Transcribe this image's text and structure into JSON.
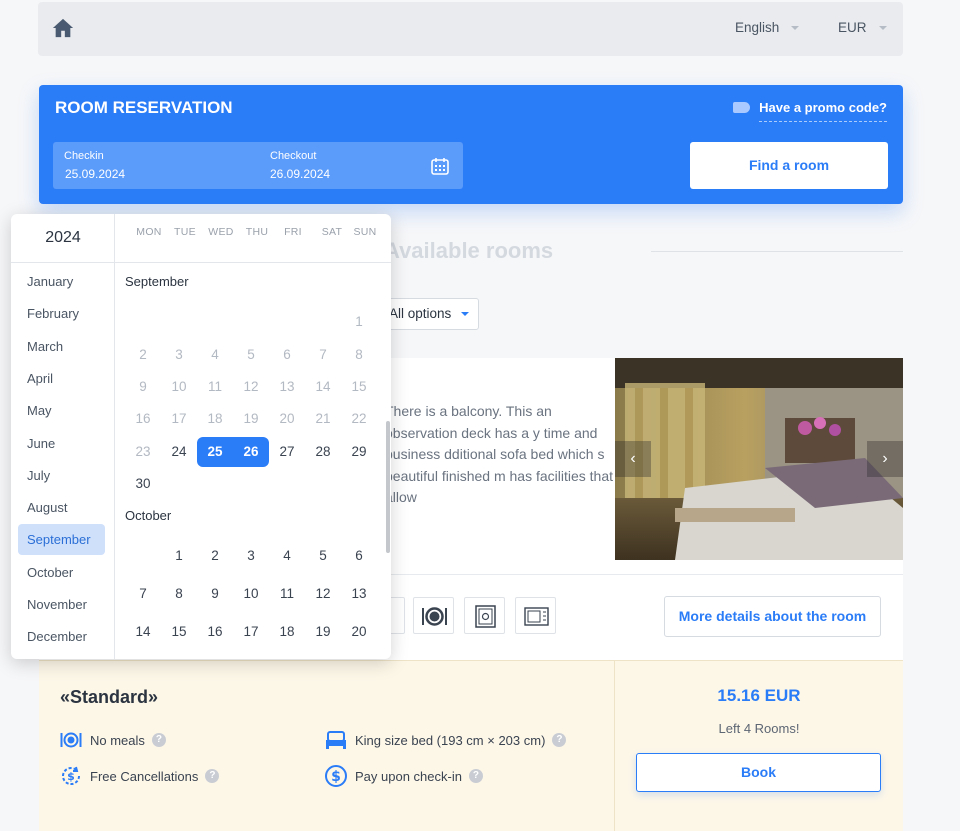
{
  "topbar": {
    "language": "English",
    "currency": "EUR"
  },
  "reservation": {
    "title": "ROOM RESERVATION",
    "promo": "Have a promo code?",
    "checkin_label": "Checkin",
    "checkin_value": "25.09.2024",
    "checkout_label": "Checkout",
    "checkout_value": "26.09.2024",
    "find_button": "Find a room"
  },
  "rooms": {
    "heading": "Available rooms",
    "filter": "All options",
    "description": "There is a balcony. This an observation deck has a y time and business dditional sofa bed which s beautiful finished m has facilities that allow",
    "more_details": "More details about the room"
  },
  "offer": {
    "title": "«Standard»",
    "features": [
      {
        "label": "No meals",
        "icon": "meals-icon"
      },
      {
        "label": "King size bed (193 cm × 203 cm)",
        "icon": "bed-icon"
      },
      {
        "label": "Free Cancellations",
        "icon": "cancellation-icon"
      },
      {
        "label": "Pay upon check-in",
        "icon": "dollar-icon"
      }
    ],
    "price": "15.16 EUR",
    "availability": "Left 4 Rooms!",
    "book_button": "Book"
  },
  "calendar": {
    "year": "2024",
    "months": [
      "January",
      "February",
      "March",
      "April",
      "May",
      "June",
      "July",
      "August",
      "September",
      "October",
      "November",
      "December"
    ],
    "selected_month": "September",
    "weekdays": [
      "MON",
      "TUE",
      "WED",
      "THU",
      "FRI",
      "SAT",
      "SUN"
    ],
    "september_label": "September",
    "october_label": "October",
    "selected_days": [
      "25",
      "26"
    ]
  },
  "colors": {
    "accent": "#2b7cf7",
    "offer_bg": "#fdf7e8"
  }
}
